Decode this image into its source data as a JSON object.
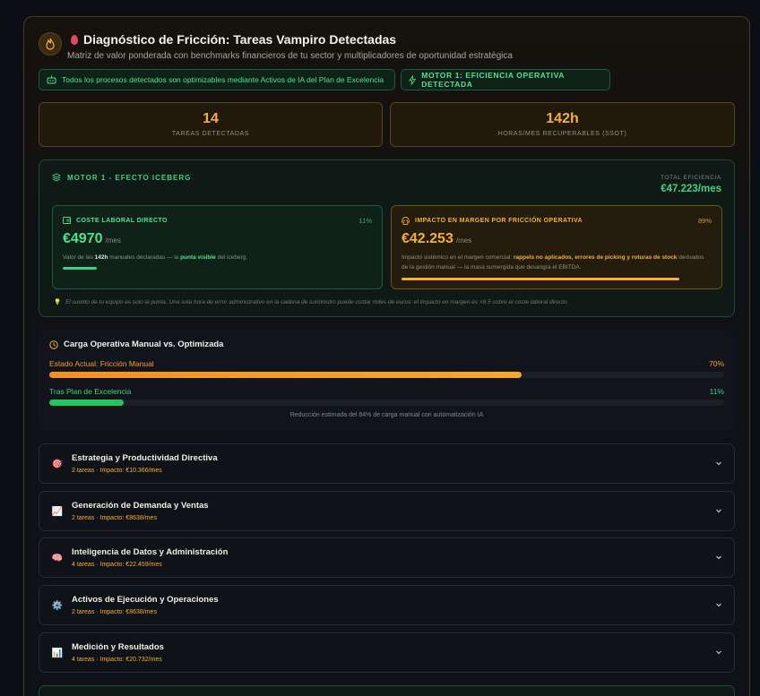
{
  "header": {
    "title": "Diagnóstico de Fricción: Tareas Vampiro Detectadas",
    "subtitle": "Matriz de valor ponderada con benchmarks financieros de tu sector y multiplicadores de oportunidad estratégica"
  },
  "chips": {
    "optimizable": "Todos los procesos detectados son optimizables mediante Activos de IA del Plan de Excelencia",
    "motor": "MOTOR 1: EFICIENCIA OPERATIVA DETECTADA"
  },
  "stats": [
    {
      "value": "14",
      "label": "TAREAS DETECTADAS"
    },
    {
      "value": "142h",
      "label": "HORAS/MES RECUPERABLES (SSOT)"
    }
  ],
  "iceberg": {
    "title": "MOTOR 1 - EFECTO ICEBERG",
    "total_label": "TOTAL EFICIENCIA",
    "total_value": "€47.223/mes",
    "direct": {
      "title": "COSTE LABORAL DIRECTO",
      "percent": "11%",
      "share": 0.11,
      "amount": "€4970",
      "unit": "/mes",
      "desc_1": "Valor de las ",
      "desc_hours": "142h",
      "desc_2": " manuales declaradas — la ",
      "desc_tip": "punta visible",
      "desc_3": " del iceberg."
    },
    "impact": {
      "title": "IMPACTO EN MARGEN POR FRICCIÓN OPERATIVA",
      "percent": "89%",
      "share": 0.89,
      "amount": "€42.253",
      "unit": "/mes",
      "desc_1": "Impacto sistémico en el margen comercial: ",
      "desc_highlight": "rappels no aplicados, errores de picking y roturas de stock",
      "desc_2": " derivados de la gestión manual — la masa sumergida que desangra el EBITDA."
    },
    "note": "El sueldo de tu equipo es solo la punta. Una sola hora de error administrativo en la cadena de suministro puede costar miles de euros: el impacto en margen es ×8.5 sobre el coste laboral directo."
  },
  "carga": {
    "title": "Carga Operativa Manual vs. Optimizada",
    "current_label": "Estado Actual: Fricción Manual",
    "current_percent": "70%",
    "current_value": 70,
    "after_label": "Tras Plan de Excelencia",
    "after_percent": "11%",
    "after_value": 11,
    "note": "Reducción estimada del 84% de carga manual con automatización IA"
  },
  "categories": [
    {
      "name": "Estrategia y Productividad Directiva",
      "meta": "2 tareas · Impacto: €10.366/mes",
      "icon": "target-icon"
    },
    {
      "name": "Generación de Demanda y Ventas",
      "meta": "2 tareas · Impacto: €8638/mes",
      "icon": "chart-up-icon"
    },
    {
      "name": "Inteligencia de Datos y Administración",
      "meta": "4 tareas · Impacto: €22.459/mes",
      "icon": "brain-icon"
    },
    {
      "name": "Activos de Ejecución y Operaciones",
      "meta": "2 tareas · Impacto: €8638/mes",
      "icon": "gear-icon"
    },
    {
      "name": "Medición y Resultados",
      "meta": "4 tareas · Impacto: €20.732/mes",
      "icon": "bar-chart-icon"
    }
  ],
  "colors": {
    "accent_amber": "#f5b030",
    "accent_green": "#3fd183",
    "current_bar": "#f5a020",
    "after_bar": "#22c55e"
  }
}
